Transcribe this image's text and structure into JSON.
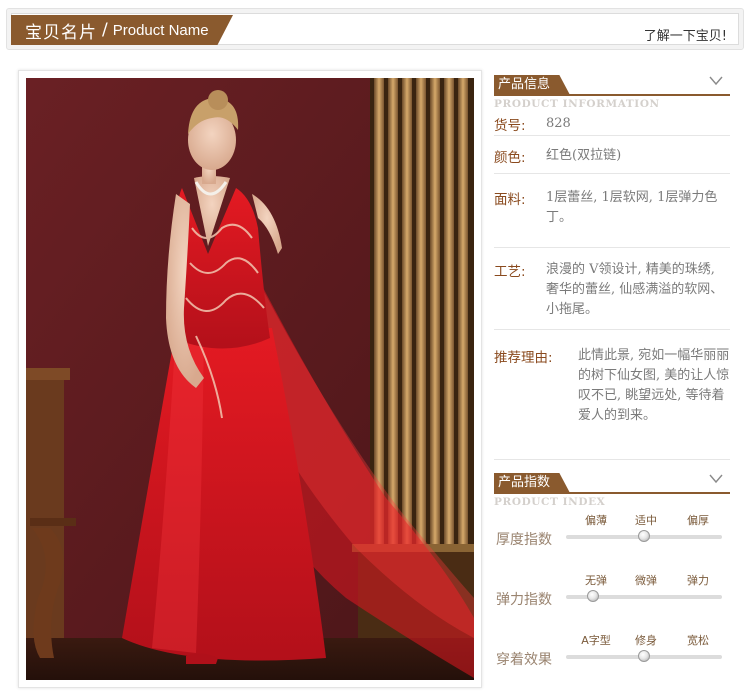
{
  "header": {
    "title_cn": "宝贝名片",
    "separator": "/",
    "title_en": "Product Name",
    "link": "了解一下宝贝!"
  },
  "product_info": {
    "title": "产品信息",
    "subtitle": "PRODUCT INFORMATION",
    "rows": [
      {
        "label": "货号:",
        "value": "828"
      },
      {
        "label": "颜色:",
        "value": "红色(双拉链)"
      },
      {
        "label": "面料:",
        "value": "1层蕾丝, 1层软网, 1层弹力色丁。"
      },
      {
        "label": "工艺:",
        "value": "浪漫的 V领设计, 精美的珠绣, 奢华的蕾丝, 仙感满溢的软网、小拖尾。"
      },
      {
        "label": "推荐理由:",
        "value": "此情此景, 宛如一幅华丽丽的树下仙女图, 美的让人惊叹不已, 眺望远处, 等待着爱人的到来。"
      }
    ]
  },
  "product_index": {
    "title": "产品指数",
    "subtitle": "PRODUCT INDEX",
    "rows": [
      {
        "label": "厚度指数",
        "options": [
          "偏薄",
          "适中",
          "偏厚"
        ],
        "level": 0.5
      },
      {
        "label": "弹力指数",
        "options": [
          "无弹",
          "微弹",
          "弹力"
        ],
        "level": 0.17
      },
      {
        "label": "穿着效果",
        "options": [
          "A字型",
          "修身",
          "宽松"
        ],
        "level": 0.5
      }
    ]
  },
  "colors": {
    "brand_brown": "#8a5a2e",
    "label_brown": "#8a4a1e",
    "dress_red": "#d8141c",
    "wall_maroon": "#5c1a1e"
  },
  "icons": {
    "section_toggle": "chevron-down-icon"
  }
}
